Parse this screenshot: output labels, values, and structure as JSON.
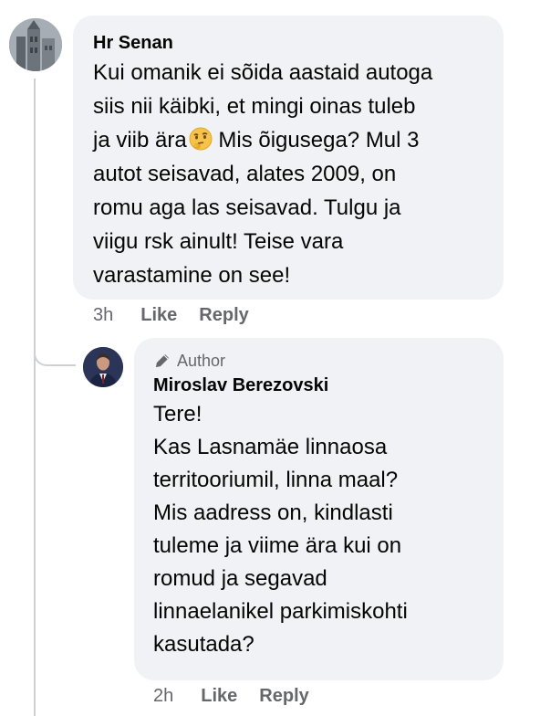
{
  "comments": [
    {
      "author": "Hr Senan",
      "text_before_emoji": "Kui omanik ei sõida aastaid autoga\nsiis nii käibki, et mingi oinas tuleb\nja viib ära",
      "emoji_icon": "thinking-face-icon",
      "text_after_emoji": " Mis õigusega? Mul 3\nautot seisavad, alates 2009, on\nromu aga las seisavad. Tulgu ja\nviigu rsk ainult! Teise vara\nvarastamine on see!",
      "time": "3h",
      "like_label": "Like",
      "reply_label": "Reply"
    },
    {
      "badge": "Author",
      "badge_icon": "pencil-icon",
      "author": "Miroslav Berezovski",
      "text": "Tere!\nKas Lasnamäe linnaosa\nterritooriumil, linna maal?\nMis aadress on, kindlasti\ntuleme ja viime ära kui on\nromud ja segavad\nlinnaelanikel parkimiskohti\nkasutada?",
      "time": "2h",
      "like_label": "Like",
      "reply_label": "Reply"
    }
  ],
  "colors": {
    "bubble": "#f0f2f5",
    "meta_text": "#65676b",
    "thread_line": "#ced0d4"
  }
}
